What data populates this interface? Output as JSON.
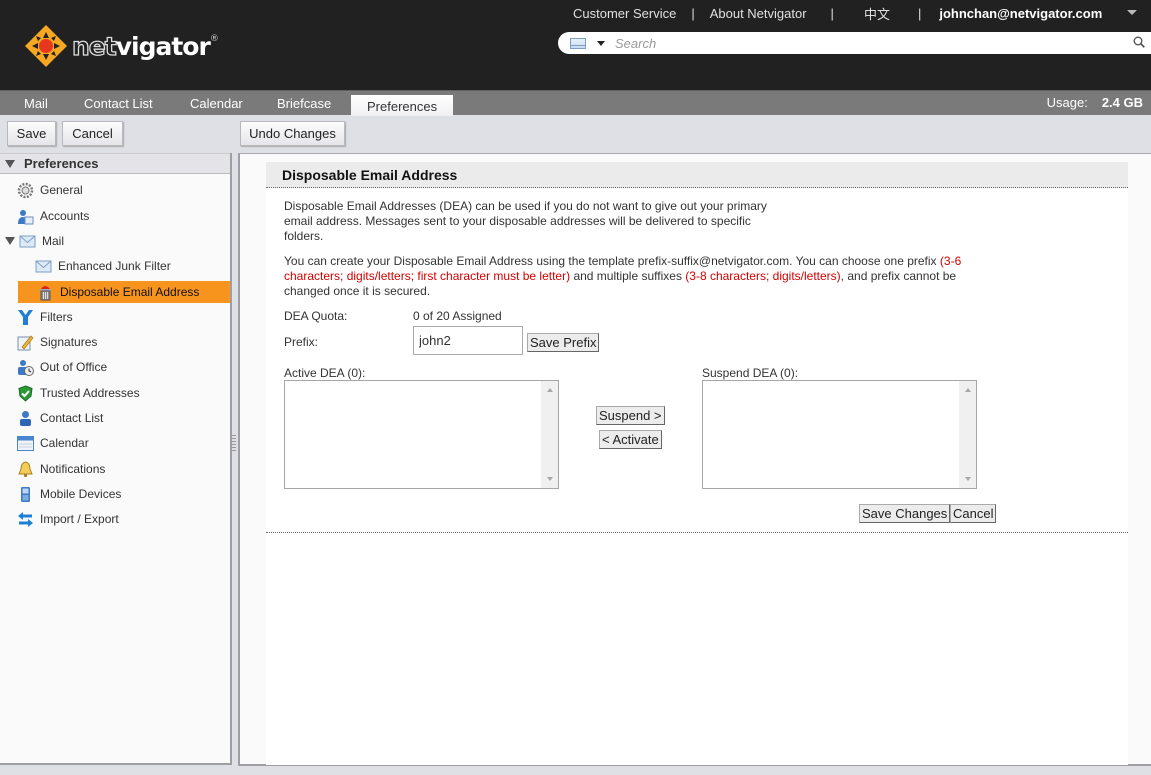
{
  "header": {
    "logo_text_a": "net",
    "logo_text_b": "vigator",
    "logo_reg": "®",
    "links": [
      "Customer Service",
      "About Netvigator",
      "中文"
    ],
    "separator": "|",
    "user": "johnchan@netvigator.com",
    "search": {
      "placeholder": "Search",
      "value": ""
    }
  },
  "tabs": [
    {
      "label": "Mail",
      "active": false
    },
    {
      "label": "Contact List",
      "active": false
    },
    {
      "label": "Calendar",
      "active": false
    },
    {
      "label": "Briefcase",
      "active": false
    },
    {
      "label": "Preferences",
      "active": true
    }
  ],
  "usage": {
    "label": "Usage:",
    "value": "2.4 GB"
  },
  "toolbar": {
    "save": "Save",
    "cancel": "Cancel",
    "undo": "Undo Changes"
  },
  "sidebar": {
    "title": "Preferences",
    "items": [
      {
        "label": "General",
        "icon": "gear-icon"
      },
      {
        "label": "Accounts",
        "icon": "accounts-icon"
      },
      {
        "label": "Mail",
        "icon": "mail-icon",
        "expanded": true
      },
      {
        "label": "Enhanced Junk Filter",
        "icon": "mail-icon"
      },
      {
        "label": "Disposable Email Address",
        "icon": "trash-icon",
        "active": true
      },
      {
        "label": "Filters",
        "icon": "filter-icon"
      },
      {
        "label": "Signatures",
        "icon": "signature-icon"
      },
      {
        "label": "Out of Office",
        "icon": "out-of-office-icon"
      },
      {
        "label": "Trusted Addresses",
        "icon": "shield-icon"
      },
      {
        "label": "Contact List",
        "icon": "contact-icon"
      },
      {
        "label": "Calendar",
        "icon": "calendar-icon"
      },
      {
        "label": "Notifications",
        "icon": "bell-icon"
      },
      {
        "label": "Mobile Devices",
        "icon": "mobile-icon"
      },
      {
        "label": "Import / Export",
        "icon": "import-export-icon"
      }
    ]
  },
  "panel": {
    "title": "Disposable Email Address",
    "intro": "Disposable Email Addresses (DEA) can be used if you do not want to give out your primary email address. Messages sent to your disposable addresses will be delivered to specific folders.",
    "rules": {
      "p1": "You can create your Disposable Email Address using the template prefix-suffix@netvigator.com. You can choose one prefix ",
      "r1": "(3-6 characters; digits/letters; first character must be letter)",
      "p2": " and multiple suffixes ",
      "r2": "(3-8 characters; digits/letters)",
      "p3": ", and prefix cannot be changed once it is secured."
    },
    "quota_label": "DEA Quota:",
    "quota_value": "0 of 20 Assigned",
    "prefix_label": "Prefix:",
    "prefix_value": "john2",
    "save_prefix": "Save Prefix",
    "active_label": "Active DEA (0):",
    "suspend_label": "Suspend DEA (0):",
    "active_items": [],
    "suspended_items": [],
    "suspend_btn": "Suspend >",
    "activate_btn": "< Activate",
    "save_changes": "Save Changes",
    "cancel": "Cancel"
  }
}
